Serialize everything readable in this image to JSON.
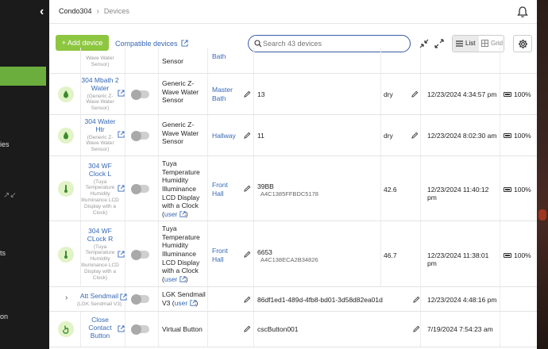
{
  "sidebar": {
    "fragments": [
      "ies",
      "ts",
      "on"
    ]
  },
  "breadcrumb": {
    "home": "Condo304",
    "current": "Devices"
  },
  "toolbar": {
    "add_label": "+ Add device",
    "compatible_label": "Compatible devices",
    "search_placeholder": "Search 43 devices",
    "view_list": "List",
    "view_grid": "Grid"
  },
  "rows": [
    {
      "name": "",
      "sub": "Wave Water Sensor)",
      "type": "Sensor",
      "room": "Bath",
      "state": "",
      "value": "",
      "date": "",
      "battery": ""
    },
    {
      "name": "304 Mbath 2 Water",
      "sub": "(Generic Z-Wave Water Sensor)",
      "type": "Generic Z-Wave Water Sensor",
      "room": "Master Bath",
      "state": "13",
      "mac": "",
      "value": "dry",
      "date": "12/23/2024 4:34:57 pm",
      "battery": "100%"
    },
    {
      "name": "304 Water Htr",
      "sub": "(Generic Z-Wave Water Sensor)",
      "type": "Generic Z-Wave Water Sensor",
      "room": "Hallway",
      "state": "11",
      "mac": "",
      "value": "dry",
      "date": "12/23/2024 8:02:30 am",
      "battery": "100%"
    },
    {
      "name": "304 WF Clock L",
      "sub": "(Tuya Temperature Humidity Illuminance LCD Display with a Clock)",
      "type": "Tuya Temperature Humidity Illuminance LCD Display with a Clock",
      "user": "user",
      "room": "Front Hall",
      "state": "39BB",
      "mac": "A4C1385FFBDC5178",
      "value": "42.6",
      "date": "12/23/2024 11:40:12 pm",
      "battery": "100%"
    },
    {
      "name": "304 WF CLock R",
      "sub": "(Tuya Temperature Humidity Illuminance LCD Display with a Clock)",
      "type": "Tuya Temperature Humidity Illuminance LCD Display with a Clock",
      "user": "user",
      "room": "Front Hall",
      "state": "6653",
      "mac": "A4C138ECA2B34826",
      "value": "46.7",
      "date": "12/23/2024 11:38:01 pm",
      "battery": "100%"
    },
    {
      "name": "Att Sendmail",
      "sub": "(LGK Sendmail V3)",
      "type": "LGK Sendmail V3",
      "user": "user",
      "room": "",
      "state": "86df1ed1-489d-4fb8-bd01-3d58d82ea01d",
      "mac": "",
      "value": "",
      "date": "12/23/2024 4:48:16 pm",
      "battery": ""
    },
    {
      "name": "Close Contact Button",
      "sub": "",
      "type": "Virtual Button",
      "room": "",
      "state": "cscButton001",
      "mac": "",
      "value": "",
      "date": "7/19/2024 7:54:23 am",
      "battery": ""
    }
  ]
}
